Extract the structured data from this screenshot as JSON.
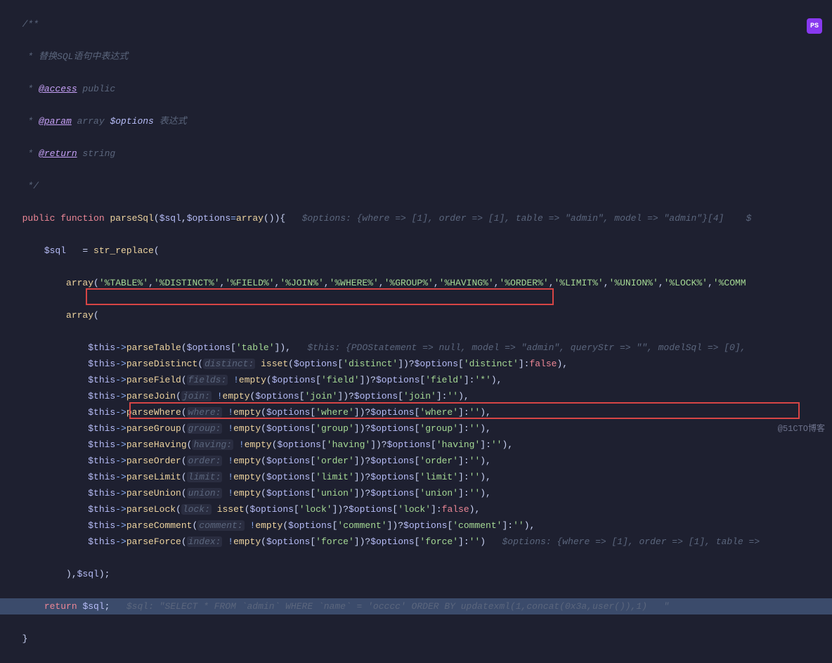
{
  "doc": {
    "l1": "/**",
    "l2_prefix": " * ",
    "l2_text": "替换SQL语句中表达式",
    "l3_prefix": " * ",
    "l3_tag": "@access",
    "l3_rest": " public",
    "l4_prefix": " * ",
    "l4_tag": "@param",
    "l4_type": " array ",
    "l4_var": "$options",
    "l4_rest": " 表达式",
    "l5_prefix": " * ",
    "l5_tag": "@return",
    "l5_rest": " string",
    "l6": " */"
  },
  "sig": {
    "kw_public": "public",
    "kw_function": "function",
    "name": "parseSql",
    "open": "(",
    "arg1": "$sql",
    "comma": ",",
    "arg2": "$options",
    "eq": "=",
    "arrcall": "array",
    "close": "()){",
    "inlay": "   $options: {where => [1], order => [1], table => \"admin\", model => \"admin\"}[4]    $"
  },
  "body": {
    "assign_var": "$sql",
    "assign_eq": "   = ",
    "fn_strr": "str_replace",
    "open": "(",
    "arr1_kw": "array",
    "arr1_open": "(",
    "tokens": [
      "'%TABLE%'",
      "'%DISTINCT%'",
      "'%FIELD%'",
      "'%JOIN%'",
      "'%WHERE%'",
      "'%GROUP%'",
      "'%HAVING%'",
      "'%ORDER%'",
      "'%LIMIT%'",
      "'%UNION%'",
      "'%LOCK%'",
      "'%COMM"
    ],
    "arr2_kw": "array",
    "arr2_open": "(",
    "calls": [
      {
        "method": "parseTable",
        "hint": "",
        "args_pre": "",
        "args": "($options['table']),",
        "key": "table",
        "inlay_after": "   $this: {PDOStatement => null, model => \"admin\", queryStr => \"\", modelSql => [0],"
      },
      {
        "method": "parseDistinct",
        "hint": " distinct: ",
        "fn": "isset",
        "key": "distinct",
        "def": "false"
      },
      {
        "method": "parseField",
        "hint": " fields: ",
        "fn": "!empty",
        "key": "field",
        "def": "'*'"
      },
      {
        "method": "parseJoin",
        "hint": " join: ",
        "fn": "!empty",
        "key": "join",
        "def": "''"
      },
      {
        "method": "parseWhere",
        "hint": " where: ",
        "fn": "!empty",
        "key": "where",
        "def": "''"
      },
      {
        "method": "parseGroup",
        "hint": " group: ",
        "fn": "!empty",
        "key": "group",
        "def": "''"
      },
      {
        "method": "parseHaving",
        "hint": " having: ",
        "fn": "!empty",
        "key": "having",
        "def": "''"
      },
      {
        "method": "parseOrder",
        "hint": " order: ",
        "fn": "!empty",
        "key": "order",
        "def": "''"
      },
      {
        "method": "parseLimit",
        "hint": " limit: ",
        "fn": "!empty",
        "key": "limit",
        "def": "''"
      },
      {
        "method": "parseUnion",
        "hint": " union: ",
        "fn": "!empty",
        "key": "union",
        "def": "''"
      },
      {
        "method": "parseLock",
        "hint": " lock: ",
        "fn": "isset",
        "key": "lock",
        "def": "false"
      },
      {
        "method": "parseComment",
        "hint": " comment: ",
        "fn": "!empty",
        "key": "comment",
        "def": "''"
      },
      {
        "method": "parseForce",
        "hint": " index: ",
        "fn": "!empty",
        "key": "force",
        "def": "''",
        "inlay_after": "   $options: {where => [1], order => [1], table =>"
      }
    ],
    "close1": "),",
    "close1_arg": "$sql",
    "close1_p": ");",
    "ret_kw": "return",
    "ret_var": "$sql",
    "ret_semi": ";",
    "ret_inlay": "   $sql: \"SELECT * FROM `admin` WHERE `name` = 'occcc' ORDER BY updatexml(1,concat(0x3a,user()),1)   \"",
    "brace": "}"
  },
  "watermark": "@51CTO博客",
  "icon_label": "PS"
}
